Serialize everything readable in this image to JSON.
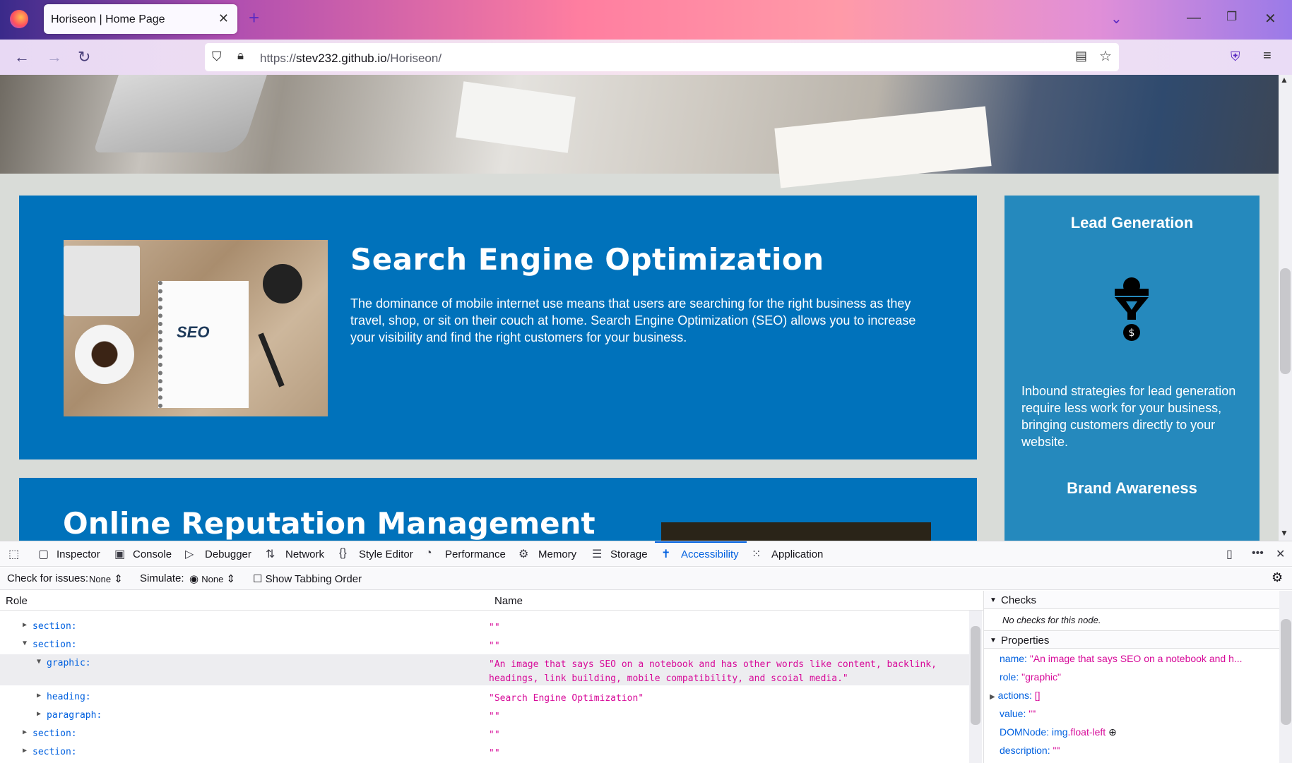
{
  "browser": {
    "tab_title": "Horiseon | Home Page",
    "tab_close": "✕",
    "new_tab": "+",
    "url_scheme": "https://",
    "url_host": "stev232.github.io",
    "url_path": "/Horiseon/"
  },
  "page": {
    "seo_title": "Search Engine Optimization",
    "seo_text": "The dominance of mobile internet use means that users are searching for the right business as they travel, shop, or sit on their couch at home. Search Engine Optimization (SEO) allows you to increase your visibility and find the right customers for your business.",
    "seo_img_word": "SEO",
    "orm_title": "Online Reputation Management",
    "side_lead_title": "Lead Generation",
    "side_lead_text": "Inbound strategies for lead generation require less work for your business, bringing customers directly to your website.",
    "side_brand_title": "Brand Awareness"
  },
  "devtools": {
    "tabs": [
      "Inspector",
      "Console",
      "Debugger",
      "Network",
      "Style Editor",
      "Performance",
      "Memory",
      "Storage",
      "Accessibility",
      "Application"
    ],
    "check_issues_label": "Check for issues:",
    "check_issues_value": "None",
    "simulate_label": "Simulate:",
    "simulate_value": "None",
    "show_tabbing": "Show Tabbing Order",
    "col_role": "Role",
    "col_name": "Name",
    "rows": [
      {
        "role": "section:",
        "name": "\"\""
      },
      {
        "role": "section:",
        "name": "\"\""
      },
      {
        "role": "graphic:",
        "name": "\"An image that says SEO on a notebook and has other words like content, backlink, headings, link building, mobile compatibility, and scoial media.\""
      },
      {
        "role": "heading:",
        "name": "\"Search Engine Optimization\""
      },
      {
        "role": "paragraph:",
        "name": "\"\""
      },
      {
        "role": "section:",
        "name": "\"\""
      },
      {
        "role": "section:",
        "name": "\"\""
      }
    ],
    "checks_header": "Checks",
    "no_checks": "No checks for this node.",
    "properties_header": "Properties",
    "props": {
      "name_k": "name:",
      "name_v": "\"An image that says SEO on a notebook and h...",
      "role_k": "role:",
      "role_v": "\"graphic\"",
      "actions_k": "actions:",
      "actions_v": "[]",
      "value_k": "value:",
      "value_v": "\"\"",
      "dom_k": "DOMNode:",
      "dom_v_tag": "img",
      "dom_v_cls": ".float-left",
      "desc_k": "description:",
      "desc_v": "\"\""
    }
  }
}
